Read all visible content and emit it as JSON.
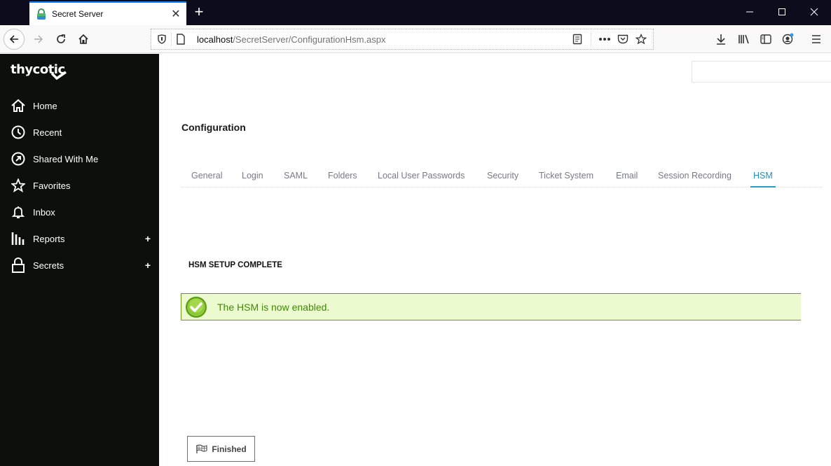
{
  "browser": {
    "tab_title": "Secret Server",
    "url_host": "localhost",
    "url_path": "/SecretServer/ConfigurationHsm.aspx"
  },
  "sidebar": {
    "logo": "thycotic",
    "items": [
      {
        "label": "Home",
        "icon": "home-icon"
      },
      {
        "label": "Recent",
        "icon": "clock-icon"
      },
      {
        "label": "Shared With Me",
        "icon": "share-icon"
      },
      {
        "label": "Favorites",
        "icon": "star-icon"
      },
      {
        "label": "Inbox",
        "icon": "bell-icon"
      },
      {
        "label": "Reports",
        "icon": "bar-chart-icon",
        "expandable": true
      },
      {
        "label": "Secrets",
        "icon": "lock-icon",
        "expandable": true
      }
    ],
    "expand_symbol": "+"
  },
  "main": {
    "title": "Configuration",
    "tabs": [
      {
        "label": "General"
      },
      {
        "label": "Login"
      },
      {
        "label": "SAML"
      },
      {
        "label": "Folders"
      },
      {
        "label": "Local User Passwords"
      },
      {
        "label": "Security"
      },
      {
        "label": "Ticket System"
      },
      {
        "label": "Email"
      },
      {
        "label": "Session Recording"
      },
      {
        "label": "HSM",
        "active": true
      }
    ],
    "section_title": "HSM SETUP COMPLETE",
    "alert_text": "The HSM is now enabled.",
    "finish_label": "Finished"
  },
  "colors": {
    "accent": "#2a9cc8",
    "success_bg": "#ecfbcf",
    "success_text": "#3e8a00",
    "sidebar_bg": "#0d0f0d"
  }
}
